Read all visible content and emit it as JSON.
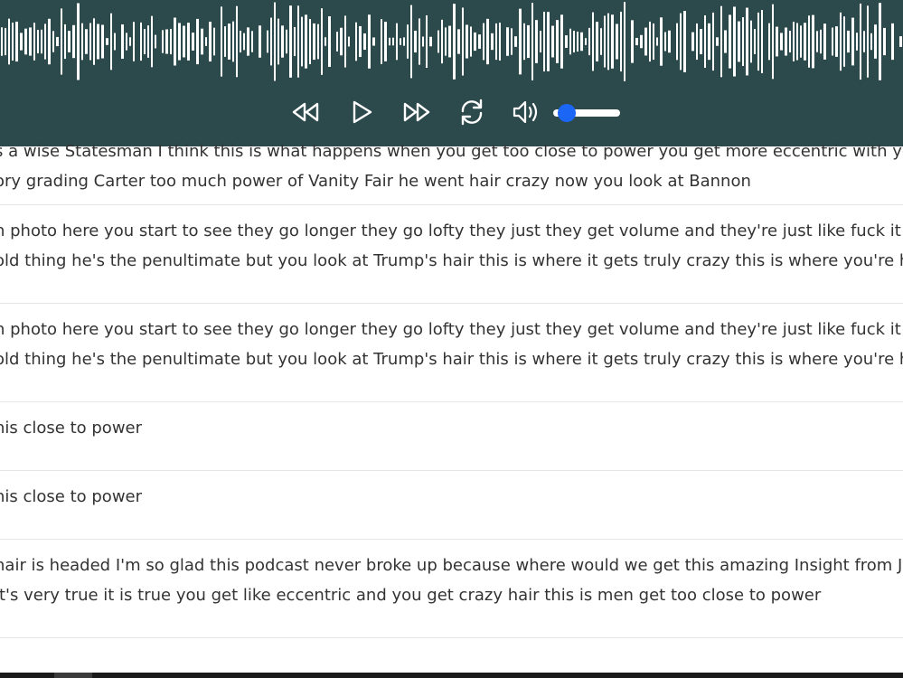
{
  "player": {
    "icons": {
      "rewind": "rewind-icon",
      "play": "play-icon",
      "fast_forward": "fast-forward-icon",
      "loop": "loop-icon",
      "volume": "volume-icon"
    },
    "volume_level": 0.1,
    "colors": {
      "background": "#2c4a4c",
      "waveform": "#ffffff",
      "accent": "#1b66f5"
    }
  },
  "transcript": [
    {
      "lines": [
        "s a wise Statesman I think this is what happens when you get too close to power you get more eccentric with your hair so",
        "ory grading Carter too much power of Vanity Fair he went hair crazy now you look at Bannon"
      ]
    },
    {
      "lines": [
        "n photo here you start to see they go longer they go lofty they just they get volume and they're just like fuck it I'm just I'm",
        "old thing he's the penultimate but you look at Trump's hair this is where it gets truly crazy this is where you're headed sack"
      ]
    },
    {
      "lines": [
        "n photo here you start to see they go longer they go lofty they just they get volume and they're just like fuck it I'm just I'm",
        "old thing he's the penultimate but you look at Trump's hair this is where it gets truly crazy this is where you're headed sack"
      ]
    },
    {
      "lines": [
        "his close to power"
      ]
    },
    {
      "lines": [
        "his close to power"
      ]
    },
    {
      "lines": [
        "hair is headed I'm so glad this podcast never broke up because where would we get this amazing Insight from Jay County",
        " it's very true it is true you get like eccentric and you get crazy hair this is men get too close to power"
      ]
    }
  ]
}
